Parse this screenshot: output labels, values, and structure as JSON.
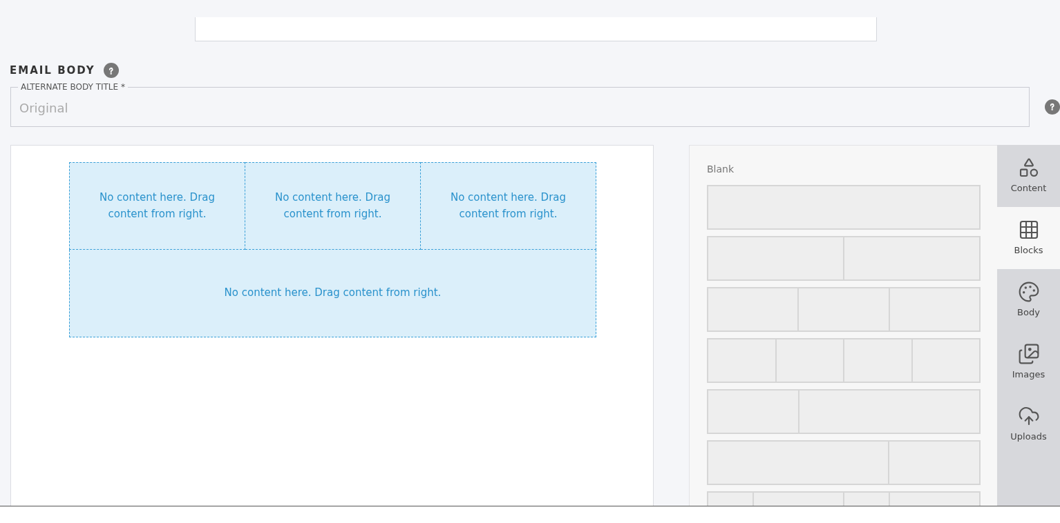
{
  "section": {
    "title": "EMAIL BODY"
  },
  "title_field": {
    "label": "ALTERNATE BODY TITLE *",
    "placeholder": "Original"
  },
  "canvas": {
    "column_drop_zones": [
      "No content here. Drag content from right.",
      "No content here. Drag content from right.",
      "No content here. Drag content from right."
    ],
    "wide_drop_zone": "No content here. Drag content from right."
  },
  "blocks_panel": {
    "heading": "Blank"
  },
  "side_tabs": [
    {
      "label": "Content",
      "selected": false
    },
    {
      "label": "Blocks",
      "selected": true
    },
    {
      "label": "Body",
      "selected": false
    },
    {
      "label": "Images",
      "selected": false
    },
    {
      "label": "Uploads",
      "selected": false
    }
  ]
}
